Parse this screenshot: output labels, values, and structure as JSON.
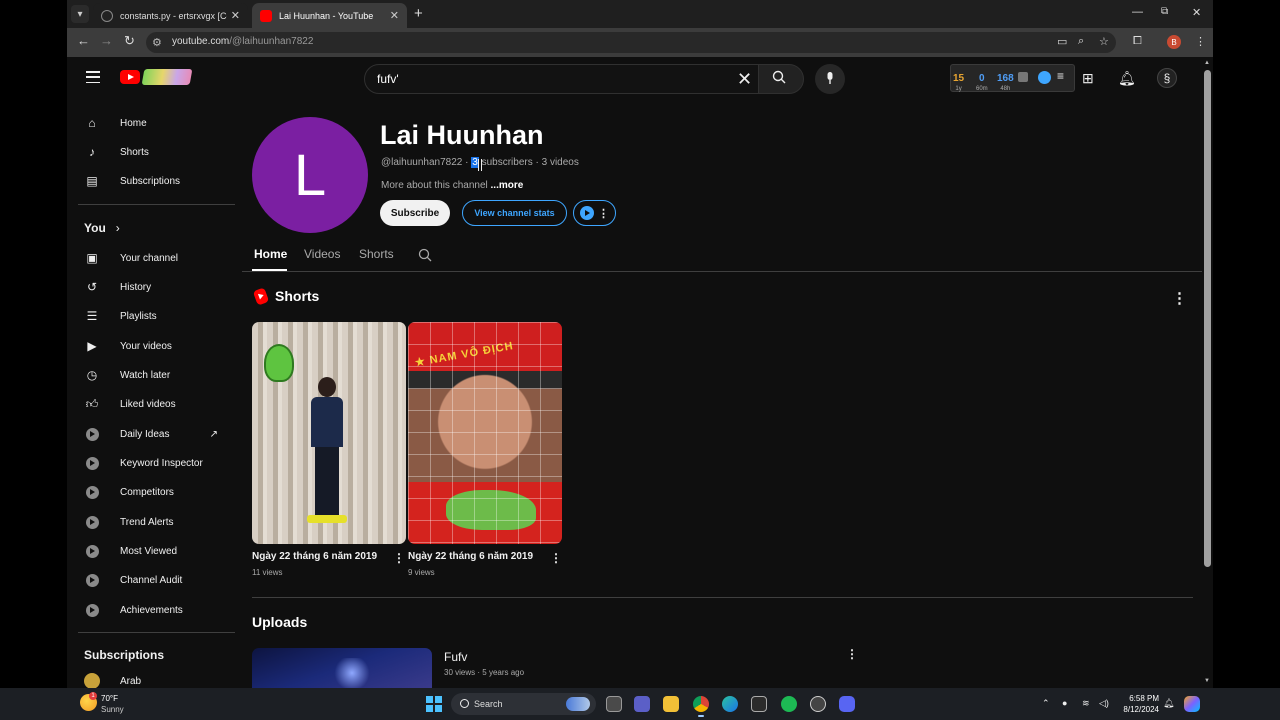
{
  "browser": {
    "tabs": [
      {
        "title": "constants.py - ertsrxvgx [Codes",
        "active": false
      },
      {
        "title": "Lai Huunhan - YouTube",
        "active": true
      }
    ],
    "new_tab": "+",
    "url_domain": "youtube.com",
    "url_path": "/@laihuunhan7822",
    "profile_letter": "B"
  },
  "masthead": {
    "search_query": "fufv'",
    "ext_stats": [
      {
        "value": "15",
        "unit": "1y",
        "color": "#e8a531"
      },
      {
        "value": "0",
        "unit": "60m",
        "color": "#4f9df5"
      },
      {
        "value": "168",
        "unit": "48h",
        "color": "#4f9df5"
      }
    ]
  },
  "sidebar": {
    "main": [
      {
        "label": "Home",
        "icon": "home-icon"
      },
      {
        "label": "Shorts",
        "icon": "shorts-icon"
      },
      {
        "label": "Subscriptions",
        "icon": "subscriptions-icon"
      }
    ],
    "you_heading": "You",
    "you_items": [
      {
        "label": "Your channel",
        "icon": "your-channel-icon"
      },
      {
        "label": "History",
        "icon": "history-icon"
      },
      {
        "label": "Playlists",
        "icon": "playlists-icon"
      },
      {
        "label": "Your videos",
        "icon": "your-videos-icon"
      },
      {
        "label": "Watch later",
        "icon": "watch-later-icon"
      },
      {
        "label": "Liked videos",
        "icon": "liked-videos-icon"
      }
    ],
    "tool_items": [
      {
        "label": "Daily Ideas"
      },
      {
        "label": "Keyword Inspector"
      },
      {
        "label": "Competitors"
      },
      {
        "label": "Trend Alerts"
      },
      {
        "label": "Most Viewed"
      },
      {
        "label": "Channel Audit"
      },
      {
        "label": "Achievements"
      }
    ],
    "subscriptions_heading": "Subscriptions",
    "subscriptions": [
      {
        "label": "Arab"
      }
    ]
  },
  "channel": {
    "avatar_letter": "L",
    "avatar_color": "#7b1fa2",
    "name": "Lai Huunhan",
    "handle": "@laihuunhan7822",
    "separator": "·",
    "subscriber_count": "3",
    "subscriber_label": " subscribers",
    "video_count": "3 videos",
    "about": "More about this channel",
    "more": "...more",
    "subscribe_label": "Subscribe",
    "stats_label": "View channel stats",
    "tabs": [
      "Home",
      "Videos",
      "Shorts"
    ]
  },
  "shorts_section": {
    "title": "Shorts",
    "items": [
      {
        "title": "Ngày 22 tháng 6 năm 2019",
        "views": "11 views"
      },
      {
        "title": "Ngày 22 tháng 6 năm 2019",
        "views": "9 views"
      }
    ]
  },
  "uploads_section": {
    "title": "Uploads",
    "items": [
      {
        "title": "Fufv",
        "views": "30 views",
        "separator": "·",
        "age": "5 years ago"
      }
    ]
  },
  "taskbar": {
    "weather_temp": "70°F",
    "weather_desc": "Sunny",
    "weather_badge": "1",
    "search_label": "Search",
    "time": "6:58 PM",
    "date": "8/12/2024"
  }
}
